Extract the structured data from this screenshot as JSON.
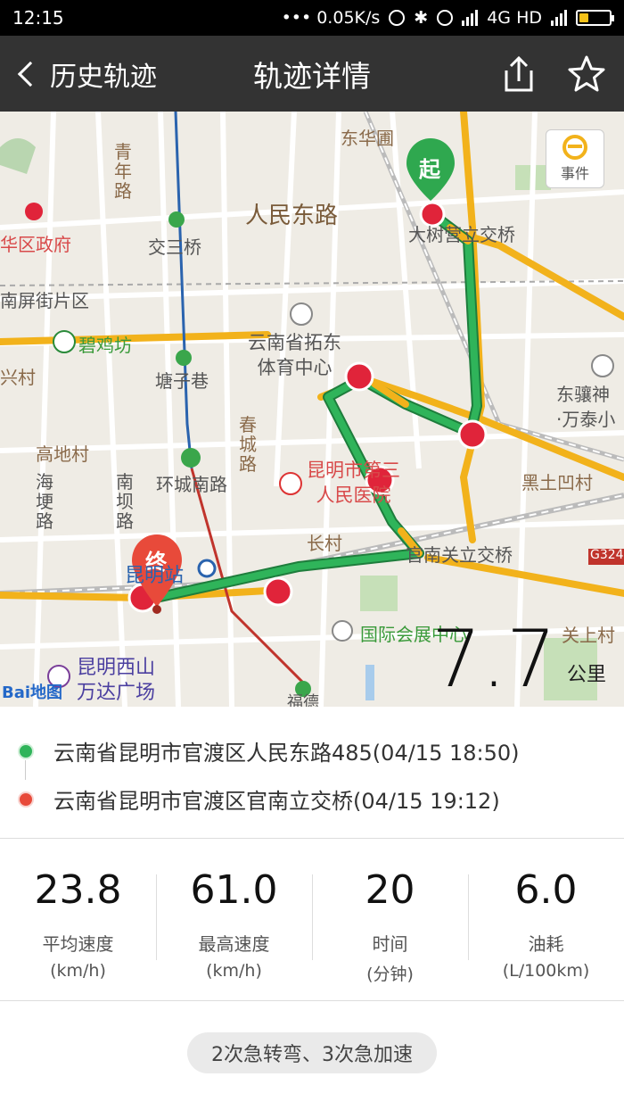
{
  "statusbar": {
    "time": "12:15",
    "net_speed": "••• 0.05K/s",
    "network": "4G HD"
  },
  "header": {
    "back_label": "历史轨迹",
    "title": "轨迹详情",
    "share_icon": "share-icon",
    "favorite_icon": "star-icon"
  },
  "map": {
    "event_button_label": "事件",
    "start_marker": "起",
    "end_marker": "终",
    "labels": {
      "donghuayuan": "东华圃",
      "renmindonglu": "人民东路",
      "qingnianlu": "青年路",
      "jiaosanqiao": "交三桥",
      "quzhengfu": "华区政府",
      "nanpingjiepian": "南屏街片区",
      "bijifang": "碧鸡坊",
      "xingcun": "兴村",
      "tangzixiang": "塘子巷",
      "tuodong": "云南省拓东\n体育中心",
      "dashuying": "大树营立交桥",
      "dongshan": "东骧神\n·万泰小",
      "gaodicun": "高地村",
      "haigenglu": "海埂路",
      "nanbalu": "南坝路",
      "huanchengnanlu": "环城南路",
      "chunchenglu": "春城路",
      "renminyiyuan": "昆明市第三\n人民医院",
      "heitu": "黑土凹村",
      "changcun": "长村",
      "guanlijiao": "官南关立交桥",
      "g324": "G324",
      "huizhan": "国际会展中心",
      "guanshang": "关上村",
      "wanda": "昆明西山\n万达广场",
      "kunmingzhan": "昆明站",
      "fude": "福德"
    },
    "distance_value": "7.7",
    "distance_unit": "公里",
    "baidu_logo": "Bai",
    "baidu_logo_tail": "地图"
  },
  "route": {
    "start_address": "云南省昆明市官渡区人民东路485(04/15 18:50)",
    "end_address": "云南省昆明市官渡区官南立交桥(04/15 19:12)"
  },
  "stats": [
    {
      "value": "23.8",
      "label": "平均速度",
      "unit": "(km/h)"
    },
    {
      "value": "61.0",
      "label": "最高速度",
      "unit": "(km/h)"
    },
    {
      "value": "20",
      "label": "时间",
      "unit": "(分钟)"
    },
    {
      "value": "6.0",
      "label": "油耗",
      "unit": "(L/100km)"
    }
  ],
  "footer": {
    "events_summary": "2次急转弯、3次急加速"
  },
  "colors": {
    "header_bg": "#333333",
    "route_green": "#2fb45a",
    "route_yellow": "#f2b21b",
    "start_dot": "#2fb45a",
    "end_dot": "#e84a3a"
  }
}
